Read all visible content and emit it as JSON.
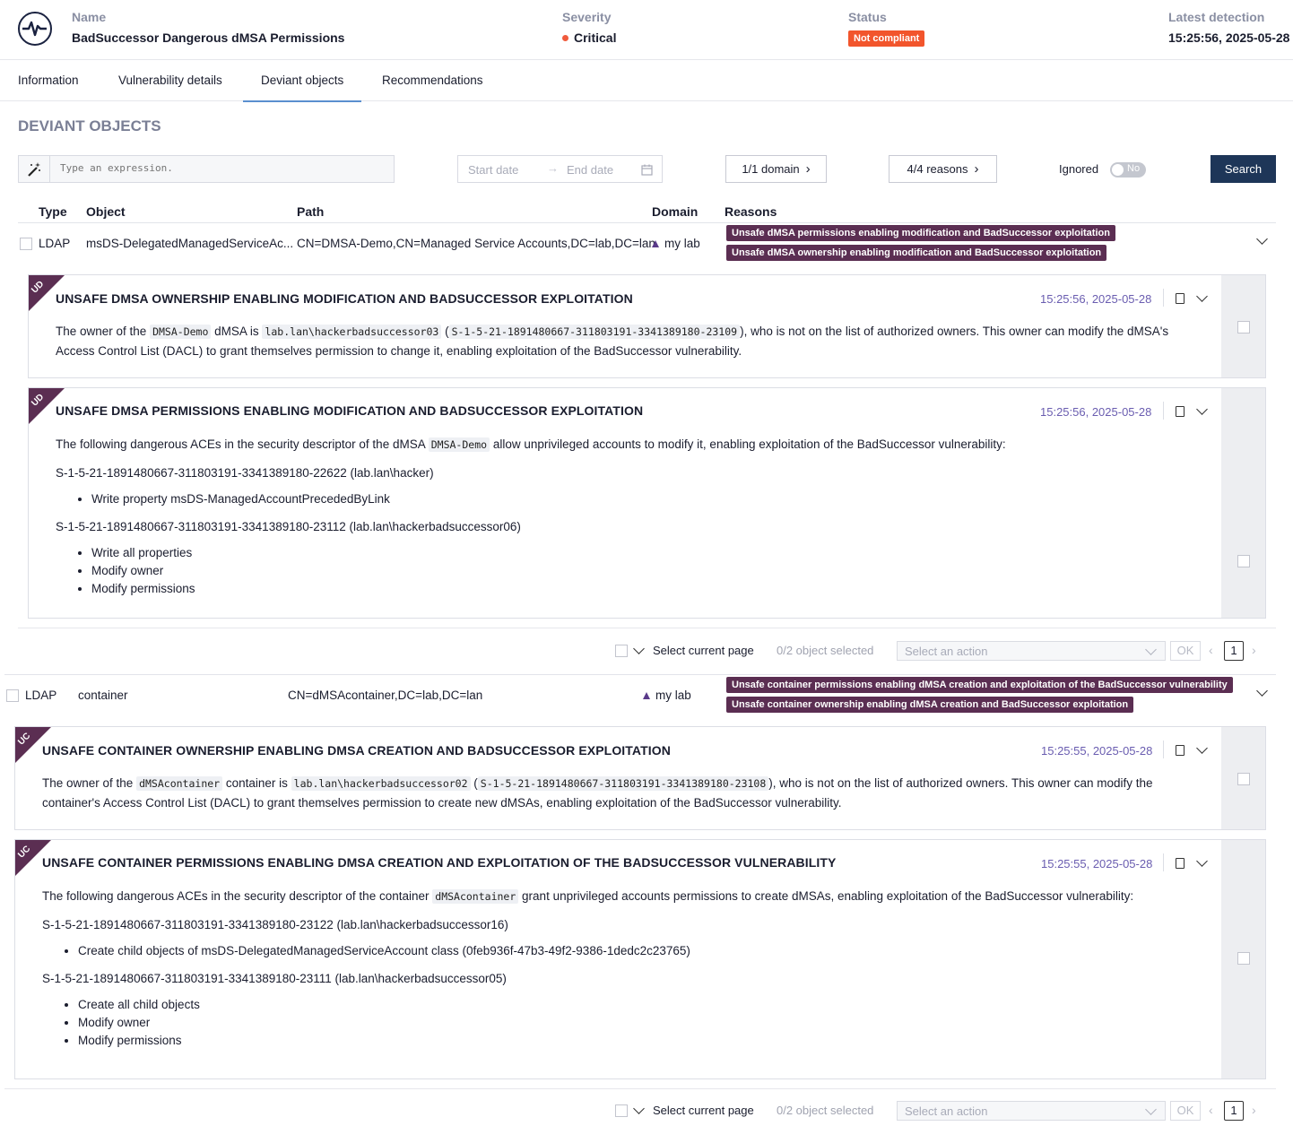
{
  "header": {
    "name_label": "Name",
    "name_value": "BadSuccessor Dangerous dMSA Permissions",
    "severity_label": "Severity",
    "severity_value": "Critical",
    "status_label": "Status",
    "status_value": "Not compliant",
    "detection_label": "Latest detection",
    "detection_value": "15:25:56, 2025-05-28",
    "colors": {
      "critical": "#f05a3c",
      "not_compliant": "#f2552c"
    }
  },
  "tabs": [
    "Information",
    "Vulnerability details",
    "Deviant objects",
    "Recommendations"
  ],
  "active_tab": "Deviant objects",
  "section_title": "DEVIANT OBJECTS",
  "toolbar": {
    "search_placeholder": "Type an expression.",
    "start_date_placeholder": "Start date",
    "end_date_placeholder": "End date",
    "domain_filter": "1/1 domain",
    "reasons_filter": "4/4 reasons",
    "ignored_label": "Ignored",
    "ignored_toggle": "No",
    "search_button": "Search"
  },
  "table": {
    "headers": [
      "Type",
      "Object",
      "Path",
      "Domain",
      "Reasons"
    ],
    "rows": [
      {
        "type": "LDAP",
        "object": "msDS-DelegatedManagedServiceAc...",
        "path": "CN=DMSA-Demo,CN=Managed Service Accounts,DC=lab,DC=lan",
        "domain": "my lab",
        "reasons": [
          "Unsafe dMSA permissions enabling modification and BadSuccessor exploitation",
          "Unsafe dMSA ownership enabling modification and BadSuccessor exploitation"
        ],
        "cards": [
          {
            "code": "UD",
            "title": "UNSAFE DMSA OWNERSHIP ENABLING MODIFICATION AND BADSUCCESSOR EXPLOITATION",
            "time": "15:25:56, 2025-05-28",
            "t1": "The owner of the",
            "c1": "DMSA-Demo",
            "t2": "dMSA is",
            "c2": "lab.lan\\hackerbadsuccessor03",
            "c3": "S-1-5-21-1891480667-311803191-3341389180-23109",
            "t3": "), who is not on the list of authorized owners. This owner can modify the dMSA's Access Control List (DACL) to grant themselves permission to change it, enabling exploitation of the BadSuccessor vulnerability."
          },
          {
            "code": "UD",
            "title": "UNSAFE DMSA PERMISSIONS ENABLING MODIFICATION AND BADSUCCESSOR EXPLOITATION",
            "time": "15:25:56, 2025-05-28",
            "t1": "The following dangerous ACEs in the security descriptor of the dMSA",
            "c1": "DMSA-Demo",
            "t2": "allow unprivileged accounts to modify it, enabling exploitation of the BadSuccessor vulnerability:",
            "sid1": "S-1-5-21-1891480667-311803191-3341389180-22622 (lab.lan\\hacker)",
            "list1": [
              "Write property msDS-ManagedAccountPrecededByLink"
            ],
            "sid2": "S-1-5-21-1891480667-311803191-3341389180-23112 (lab.lan\\hackerbadsuccessor06)",
            "list2": [
              "Write all properties",
              "Modify owner",
              "Modify permissions"
            ]
          }
        ]
      },
      {
        "type": "LDAP",
        "object": "container",
        "path": "CN=dMSAcontainer,DC=lab,DC=lan",
        "domain": "my lab",
        "reasons": [
          "Unsafe container permissions enabling dMSA creation and exploitation of the BadSuccessor vulnerability",
          "Unsafe container ownership enabling dMSA creation and BadSuccessor exploitation"
        ],
        "cards": [
          {
            "code": "UC",
            "title": "UNSAFE CONTAINER OWNERSHIP ENABLING DMSA CREATION AND BADSUCCESSOR EXPLOITATION",
            "time": "15:25:55, 2025-05-28",
            "t1": "The owner of the",
            "c1": "dMSAcontainer",
            "t2": "container is",
            "c2": "lab.lan\\hackerbadsuccessor02",
            "c3": "S-1-5-21-1891480667-311803191-3341389180-23108",
            "t3": "), who is not on the list of authorized owners. This owner can modify the container's Access Control List (DACL) to grant themselves permission to create new dMSAs, enabling exploitation of the BadSuccessor vulnerability."
          },
          {
            "code": "UC",
            "title": "UNSAFE CONTAINER PERMISSIONS ENABLING DMSA CREATION AND EXPLOITATION OF THE BADSUCCESSOR VULNERABILITY",
            "time": "15:25:55, 2025-05-28",
            "t1": "The following dangerous ACEs in the security descriptor of the container",
            "c1": "dMSAcontainer",
            "t2": "grant unprivileged accounts permissions to create dMSAs, enabling exploitation of the BadSuccessor vulnerability:",
            "sid1": "S-1-5-21-1891480667-311803191-3341389180-23122 (lab.lan\\hackerbadsuccessor16)",
            "list1": [
              "Create child objects of msDS-DelegatedManagedServiceAccount class (0feb936f-47b3-49f2-9386-1dedc2c23765)"
            ],
            "sid2": "S-1-5-21-1891480667-311803191-3341389180-23111 (lab.lan\\hackerbadsuccessor05)",
            "list2": [
              "Create all child objects",
              "Modify owner",
              "Modify permissions"
            ]
          }
        ]
      }
    ]
  },
  "footer": {
    "select_page": "Select current page",
    "selected_count": "0/2 object selected",
    "action_placeholder": "Select an action",
    "ok": "OK",
    "page": "1"
  }
}
